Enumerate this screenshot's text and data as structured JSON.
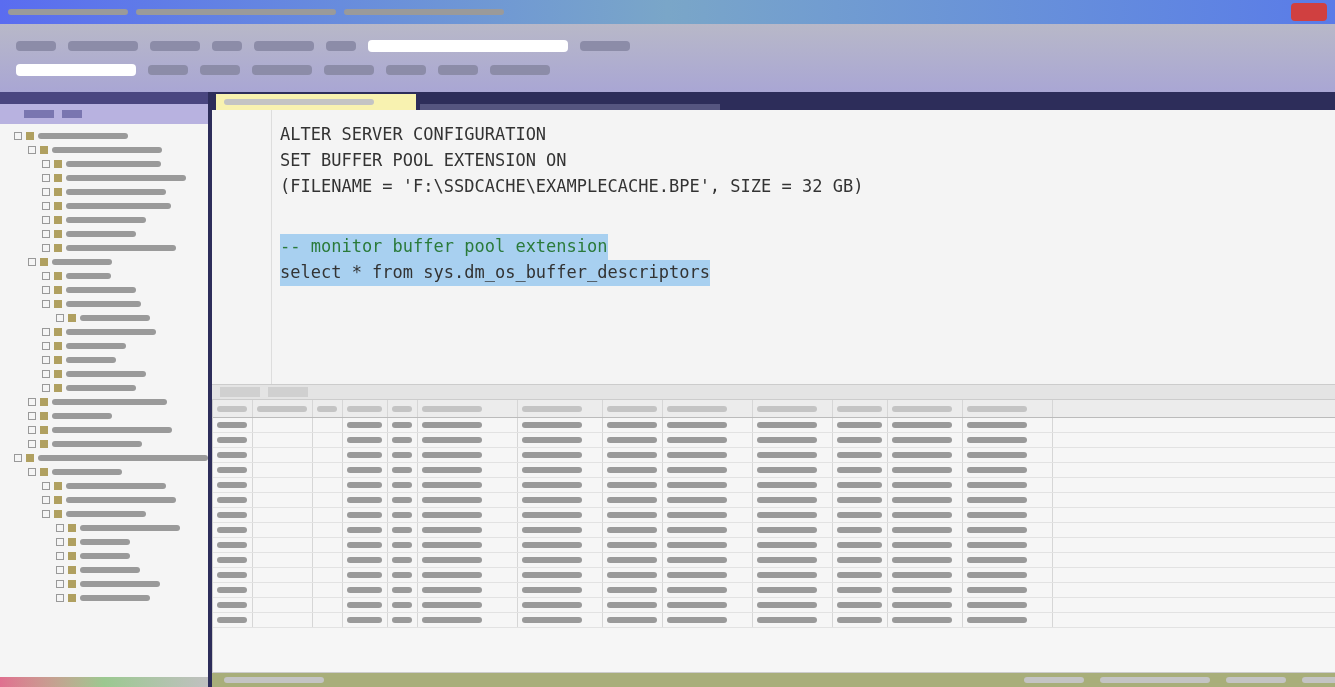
{
  "editor": {
    "lines": [
      {
        "kind": "code",
        "text": "ALTER SERVER CONFIGURATION",
        "selected": false
      },
      {
        "kind": "code",
        "text": "SET BUFFER POOL EXTENSION ON",
        "selected": false
      },
      {
        "kind": "code",
        "text": "(FILENAME = 'F:\\SSDCACHE\\EXAMPLECACHE.BPE', SIZE = 32 GB)",
        "selected": false
      },
      {
        "kind": "blank"
      },
      {
        "kind": "comment",
        "text": "-- monitor buffer pool extension",
        "selected": true
      },
      {
        "kind": "code",
        "text": "select * from sys.dm_os_buffer_descriptors",
        "selected": true
      }
    ]
  }
}
